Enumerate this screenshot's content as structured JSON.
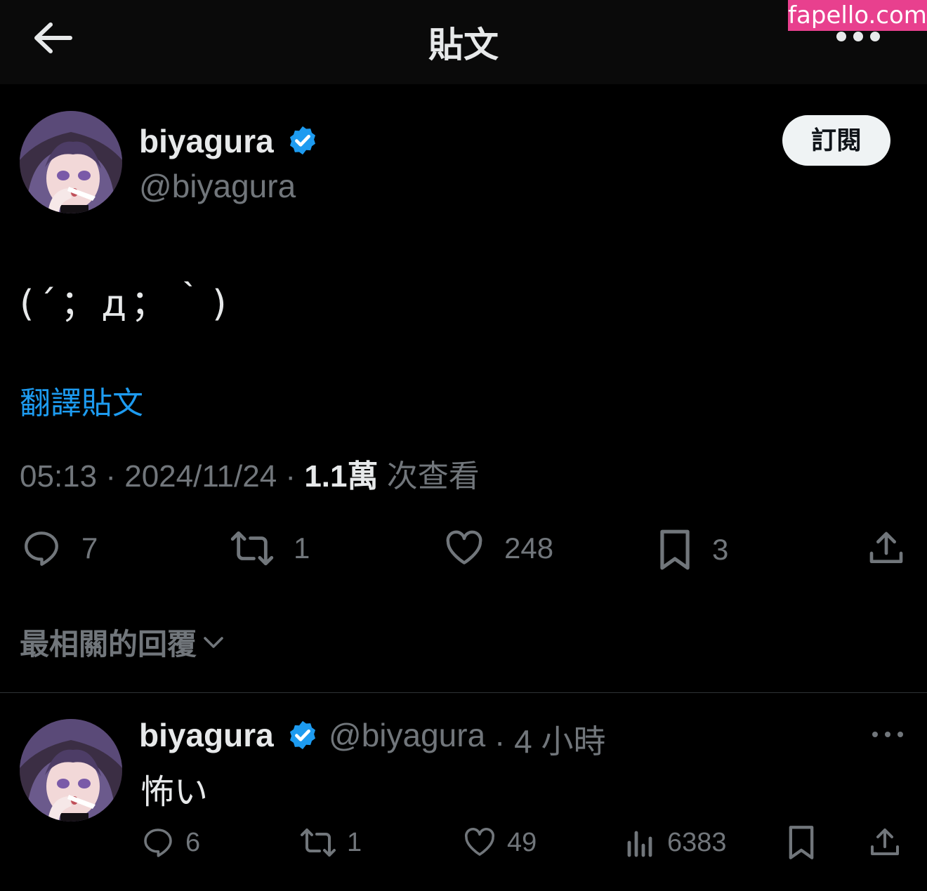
{
  "header": {
    "title": "貼文",
    "back_icon": "arrow-left-icon",
    "more_icon": "more-horizontal-icon"
  },
  "watermark": "fapello.com",
  "tweet": {
    "author": {
      "name": "biyagura",
      "handle": "@biyagura",
      "verified": true
    },
    "subscribe_label": "訂閱",
    "text": "(´；д；｀)",
    "translate_label": "翻譯貼文",
    "time": "05:13",
    "date": "2024/11/24",
    "separator": "·",
    "views_count": "1.1萬",
    "views_label": "次查看",
    "stats": {
      "replies": "7",
      "retweets": "1",
      "likes": "248",
      "bookmarks": "3"
    }
  },
  "replies_sort_label": "最相關的回覆",
  "reply": {
    "author": {
      "name": "biyagura",
      "handle": "@biyagura",
      "verified": true
    },
    "time": "· 4 小時",
    "text": "怖い",
    "stats": {
      "replies": "6",
      "retweets": "1",
      "likes": "49",
      "views": "6383"
    }
  },
  "colors": {
    "background": "#000000",
    "text": "#e7e9ea",
    "muted": "#71767b",
    "link": "#1d9bf0",
    "verified": "#1d9bf0",
    "watermark": "#e8408e"
  }
}
